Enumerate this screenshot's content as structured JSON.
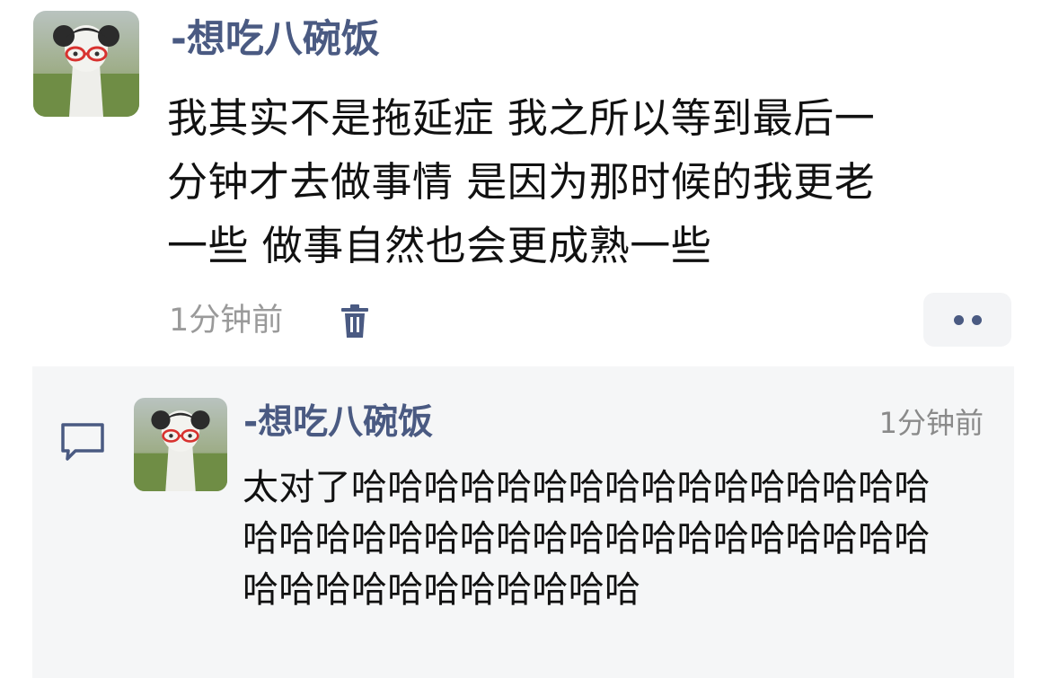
{
  "post": {
    "username": "-想吃八碗饭",
    "lines": [
      "我其实不是拖延症 我之所以等到最后一",
      "分钟才去做事情 是因为那时候的我更老",
      "一些 做事自然也会更成熟一些"
    ],
    "time": "1分钟前",
    "delete_icon": "trash-icon",
    "more_icon": "more-dots-icon"
  },
  "reply": {
    "comment_icon": "comment-bubble-icon",
    "username": "-想吃八碗饭",
    "time": "1分钟前",
    "text": "太对了哈哈哈哈哈哈哈哈哈哈哈哈哈哈哈哈哈哈哈哈哈哈哈哈哈哈哈哈哈哈哈哈哈哈哈哈哈哈哈哈哈哈哈哈哈哈"
  },
  "colors": {
    "username": "#4a5a82",
    "meta": "#9a9a9a",
    "reply_bg": "#f5f6f7"
  }
}
